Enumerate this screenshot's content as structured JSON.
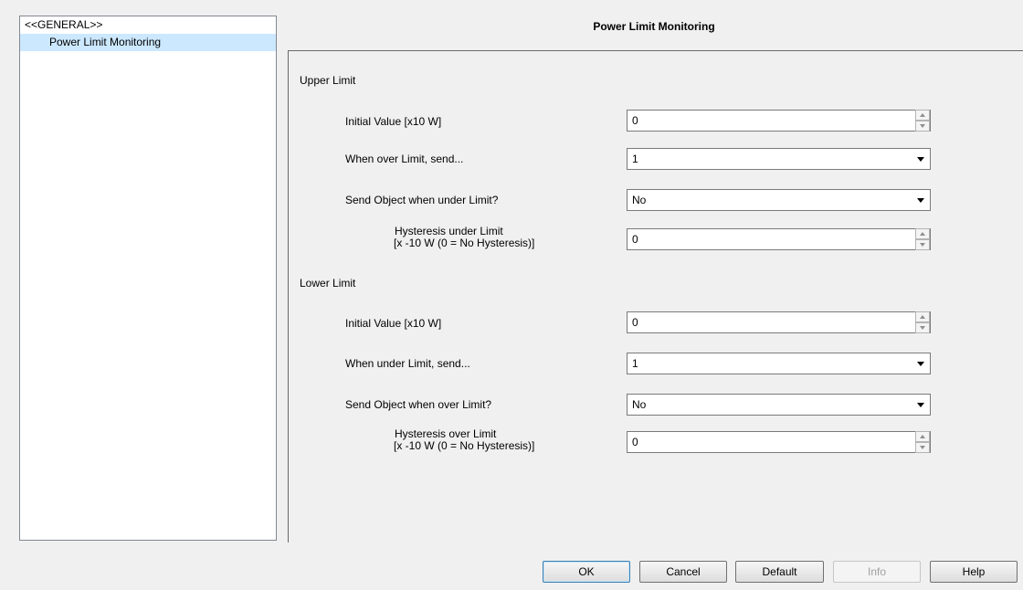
{
  "tree": {
    "root_label": "<<GENERAL>>",
    "items": [
      {
        "label": "Power Limit Monitoring"
      }
    ]
  },
  "page": {
    "title": "Power Limit Monitoring"
  },
  "upper": {
    "section_label": "Upper Limit",
    "initial_label": "Initial Value [x10 W]",
    "initial_value": "0",
    "send_label": "When over Limit, send...",
    "send_value": "1",
    "send_object_label": "Send Object when under Limit?",
    "send_object_value": "No",
    "hyst_label_1": "Hysteresis under Limit",
    "hyst_label_2": "[x -10 W (0 = No Hysteresis)]",
    "hyst_value": "0"
  },
  "lower": {
    "section_label": "Lower Limit",
    "initial_label": "Initial Value [x10 W]",
    "initial_value": "0",
    "send_label": "When under Limit, send...",
    "send_value": "1",
    "send_object_label": "Send Object when over Limit?",
    "send_object_value": "No",
    "hyst_label_1": "Hysteresis over Limit",
    "hyst_label_2": "[x -10 W (0 = No Hysteresis)]",
    "hyst_value": "0"
  },
  "buttons": {
    "ok": "OK",
    "cancel": "Cancel",
    "default": "Default",
    "info": "Info",
    "help": "Help"
  },
  "colors": {
    "selection": "#cce8ff",
    "focus_border": "#3c7fb1"
  }
}
